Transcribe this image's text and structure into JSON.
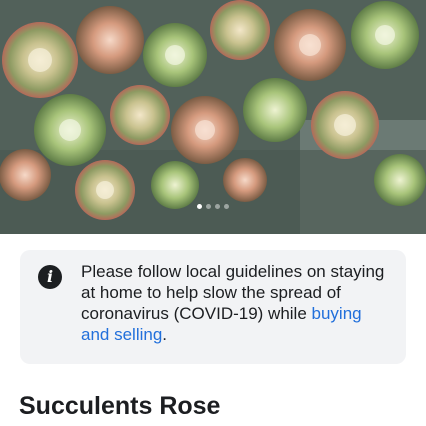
{
  "listing": {
    "photo_icon": "succulent-photo",
    "carousel": {
      "total": 4,
      "active": 1
    },
    "title": "Succulents Rose"
  },
  "notice": {
    "icon": "info-icon",
    "text": "Please follow local guidelines on staying at home to help slow the spread of coronavirus (COVID-19) while ",
    "link_text": "buying and selling",
    "text_end": ".",
    "colors": {
      "background": "#f2f3f5",
      "link": "#216fdb"
    }
  }
}
